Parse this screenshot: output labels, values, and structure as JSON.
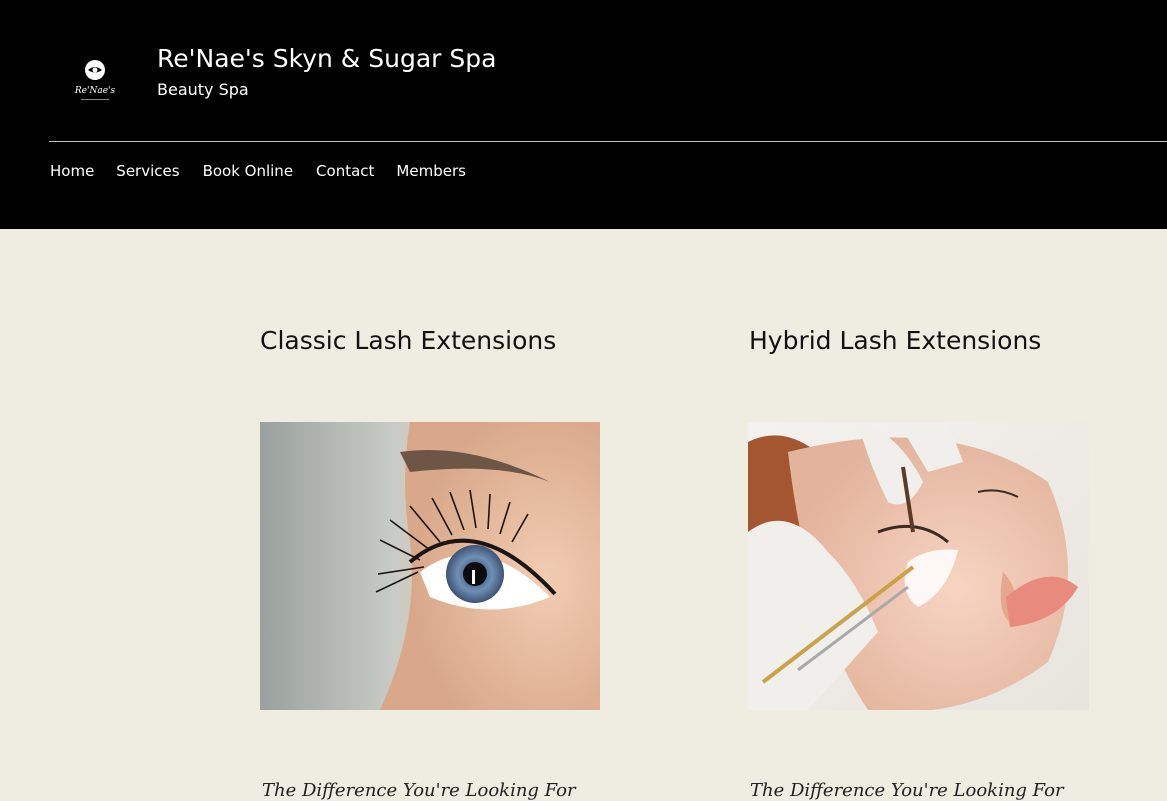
{
  "header": {
    "title": "Re'Nae's Skyn & Sugar Spa",
    "subtitle": "Beauty Spa",
    "logo_text": "Re'Nae's"
  },
  "nav": {
    "items": [
      {
        "label": "Home"
      },
      {
        "label": "Services"
      },
      {
        "label": "Book Online"
      },
      {
        "label": "Contact"
      },
      {
        "label": "Members"
      }
    ]
  },
  "services": [
    {
      "title": "Classic Lash Extensions",
      "image_icon": "eye-closeup-photo",
      "tagline": "The Difference You're Looking For"
    },
    {
      "title": "Hybrid Lash Extensions",
      "image_icon": "lash-application-photo",
      "tagline": "The Difference You're Looking For"
    }
  ],
  "colors": {
    "header_bg": "#000000",
    "page_bg": "#efece2",
    "text_dark": "#111111",
    "text_light": "#ffffff"
  }
}
